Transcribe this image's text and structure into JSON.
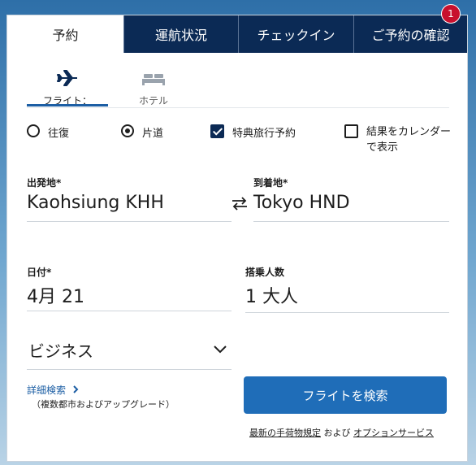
{
  "tabs": [
    {
      "label": "予約"
    },
    {
      "label": "運航状況"
    },
    {
      "label": "チェックイン"
    },
    {
      "label": "ご予約の確認",
      "badge": "1"
    }
  ],
  "modes": {
    "flight": {
      "label": "フライト：",
      "icon": "airplane-icon"
    },
    "hotel": {
      "label": "ホテル",
      "icon": "bed-icon"
    }
  },
  "trip": {
    "roundtrip_label": "往復",
    "oneway_label": "片道",
    "selected": "oneway"
  },
  "options": {
    "award_label": "特典旅行予約",
    "award_checked": true,
    "calendar_label": "結果をカレンダーで表示",
    "calendar_checked": false
  },
  "origin": {
    "label": "出発地*",
    "value": "Kaohsiung KHH"
  },
  "destination": {
    "label": "到着地*",
    "value": "Tokyo HND"
  },
  "date": {
    "label": "日付*",
    "value": "4月 21"
  },
  "passengers": {
    "label": "搭乗人数",
    "value": "1 大人"
  },
  "cabin": {
    "value": "ビジネス"
  },
  "advanced": {
    "link": "詳細検索",
    "note": "（複数都市およびアップグレード）"
  },
  "search_button": "フライトを検索",
  "footer": {
    "baggage_link": "最新の手荷物規定",
    "and": " および ",
    "services_link": "オプションサービス"
  },
  "colors": {
    "navy": "#0b2a55",
    "accent": "#1f6db8",
    "badge": "#c8102e"
  }
}
